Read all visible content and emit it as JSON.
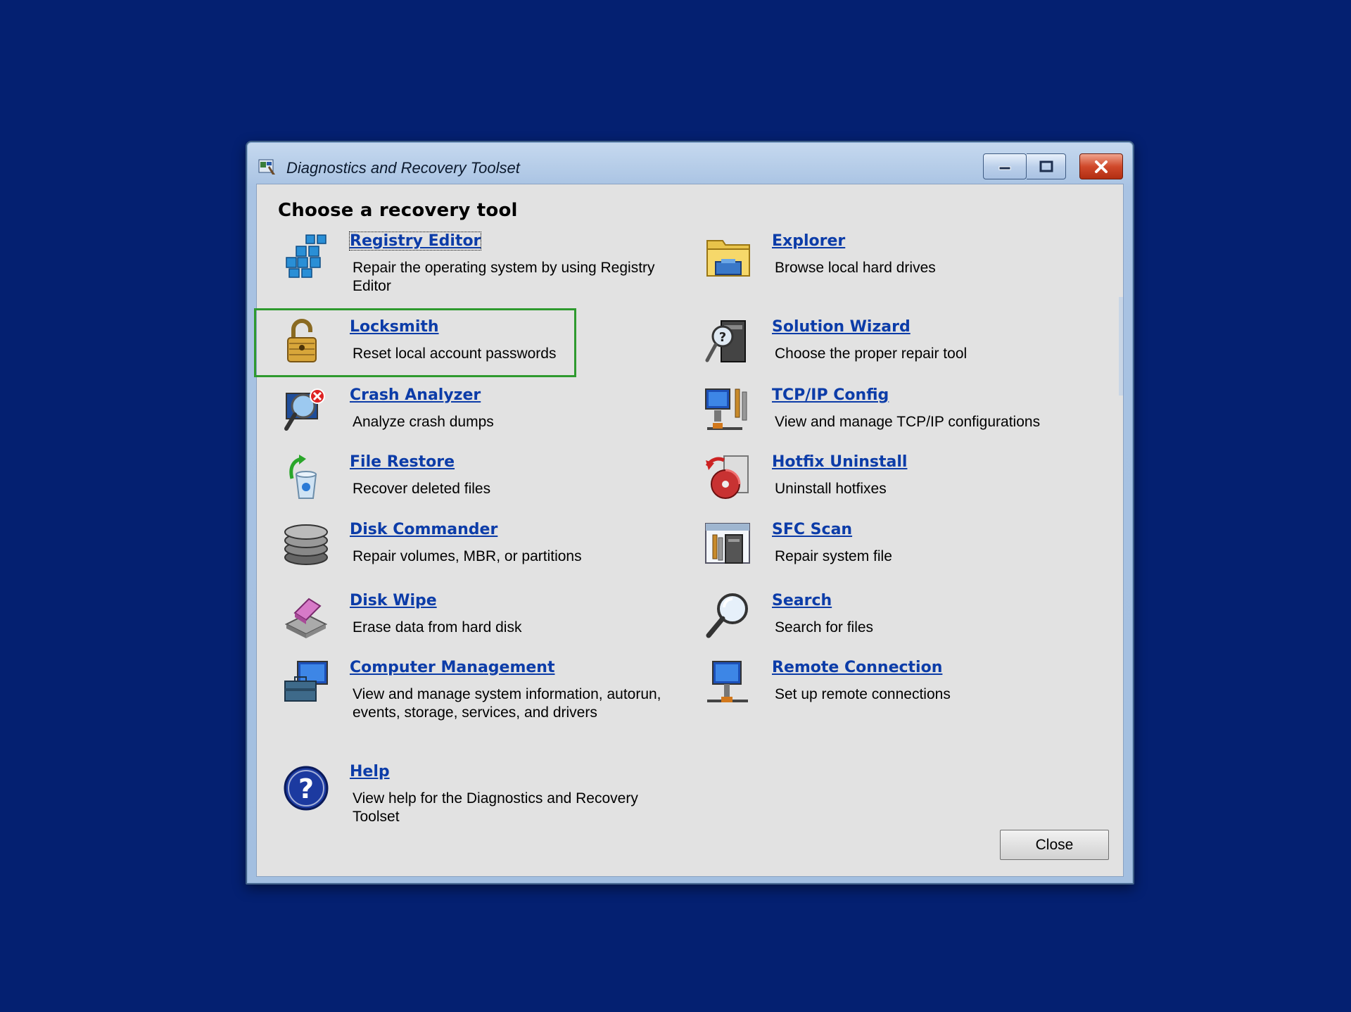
{
  "window": {
    "title": "Diagnostics and Recovery Toolset"
  },
  "heading": "Choose a recovery tool",
  "tools_left": [
    {
      "title": "Registry Editor",
      "desc": "Repair the operating system by using Registry Editor",
      "icon": "registry-cubes-icon"
    },
    {
      "title": "Locksmith",
      "desc": "Reset local account passwords",
      "icon": "padlock-icon"
    },
    {
      "title": "Crash Analyzer",
      "desc": "Analyze crash dumps",
      "icon": "crash-magnifier-icon"
    },
    {
      "title": "File Restore",
      "desc": "Recover deleted files",
      "icon": "recycle-bin-restore-icon"
    },
    {
      "title": "Disk Commander",
      "desc": "Repair volumes, MBR, or partitions",
      "icon": "disk-stack-icon"
    },
    {
      "title": "Disk Wipe",
      "desc": "Erase data from hard disk",
      "icon": "eraser-disk-icon"
    },
    {
      "title": "Computer Management",
      "desc": "View and manage system information, autorun, events, storage, services, and drivers",
      "icon": "computer-toolbox-icon"
    },
    {
      "title": "Help",
      "desc": "View help for the Diagnostics and Recovery Toolset",
      "icon": "help-question-icon"
    }
  ],
  "tools_right": [
    {
      "title": "Explorer",
      "desc": "Browse local hard drives",
      "icon": "folder-explorer-icon"
    },
    {
      "title": "Solution Wizard",
      "desc": "Choose the proper repair tool",
      "icon": "wizard-magnifier-icon"
    },
    {
      "title": "TCP/IP Config",
      "desc": "View and manage TCP/IP configurations",
      "icon": "network-config-icon"
    },
    {
      "title": "Hotfix Uninstall",
      "desc": "Uninstall hotfixes",
      "icon": "hotfix-disc-icon"
    },
    {
      "title": "SFC Scan",
      "desc": "Repair system file",
      "icon": "sfc-scan-icon"
    },
    {
      "title": "Search",
      "desc": "Search for files",
      "icon": "search-magnifier-icon"
    },
    {
      "title": "Remote Connection",
      "desc": "Set up remote connections",
      "icon": "remote-monitor-icon"
    }
  ],
  "buttons": {
    "close": "Close"
  },
  "colors": {
    "desktop": "#042071",
    "link": "#0c3ca8",
    "highlight_border": "#2e9a2e",
    "client_bg": "#e2e2e2"
  }
}
